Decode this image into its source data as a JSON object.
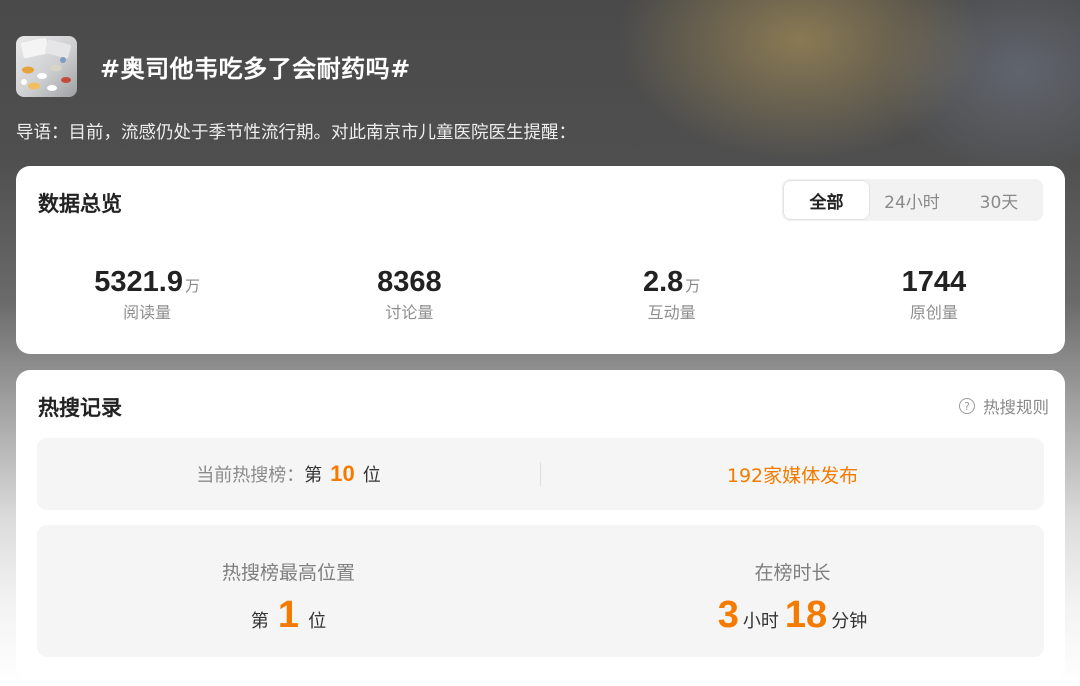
{
  "topic": {
    "title": "#奥司他韦吃多了会耐药吗#",
    "lead": "导语：目前，流感仍处于季节性流行期。对此南京市儿童医院医生提醒："
  },
  "overview": {
    "title": "数据总览",
    "tabs": [
      {
        "label": "全部",
        "active": true
      },
      {
        "label": "24小时",
        "active": false
      },
      {
        "label": "30天",
        "active": false
      }
    ],
    "stats": [
      {
        "value": "5321.9",
        "unit": "万",
        "label": "阅读量"
      },
      {
        "value": "8368",
        "unit": "",
        "label": "讨论量"
      },
      {
        "value": "2.8",
        "unit": "万",
        "label": "互动量"
      },
      {
        "value": "1744",
        "unit": "",
        "label": "原创量"
      }
    ]
  },
  "hot": {
    "title": "热搜记录",
    "rules_link": "热搜规则",
    "help_glyph": "?",
    "current_prefix": "当前热搜榜：",
    "current_di": "第",
    "current_rank": "10",
    "current_wei": "位",
    "media": "192家媒体发布",
    "peak_label": "热搜榜最高位置",
    "peak_di": "第",
    "peak_rank": "1",
    "peak_wei": "位",
    "duration_label": "在榜时长",
    "hours": "3",
    "hours_unit": "小时",
    "minutes": "18",
    "minutes_unit": "分钟"
  },
  "colors": {
    "accent": "#f47b00",
    "text": "#222222",
    "muted": "#8a8a8a"
  }
}
